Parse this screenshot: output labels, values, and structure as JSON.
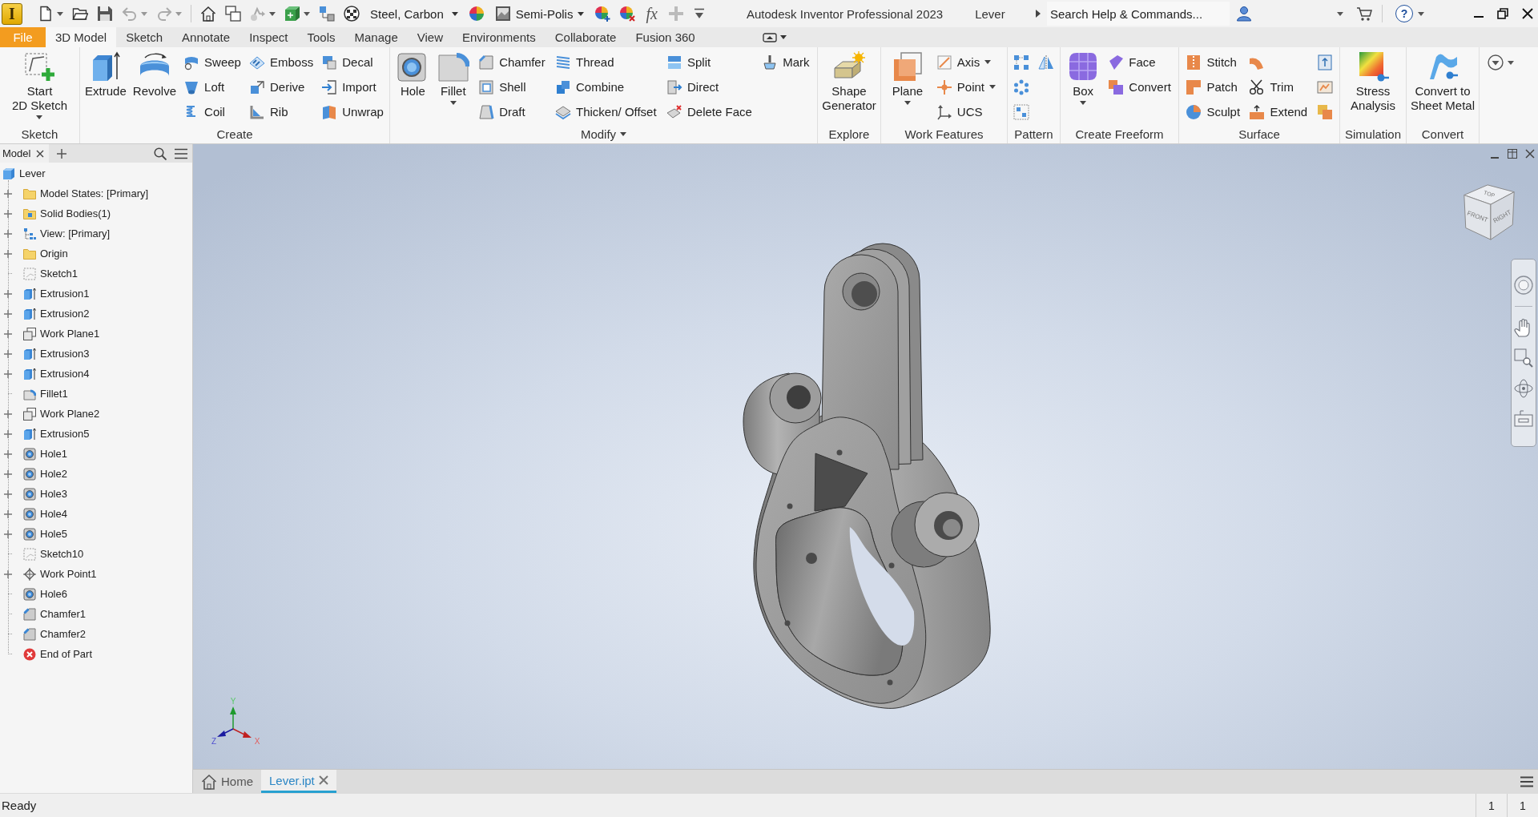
{
  "quick_access": {
    "logo": "I",
    "material": "Steel, Carbon",
    "appearance": "Semi-Polis",
    "parameters": "fx"
  },
  "title_bar": {
    "title": "Autodesk Inventor Professional 2023",
    "document": "Lever",
    "search": {
      "placeholder": "Search Help & Commands..."
    },
    "help": "?"
  },
  "ribbon_tabs": [
    {
      "label": "File",
      "kind": "file",
      "selected": false
    },
    {
      "label": "3D Model",
      "kind": "tab",
      "selected": true
    },
    {
      "label": "Sketch",
      "kind": "tab",
      "selected": false
    },
    {
      "label": "Annotate",
      "kind": "tab",
      "selected": false
    },
    {
      "label": "Inspect",
      "kind": "tab",
      "selected": false
    },
    {
      "label": "Tools",
      "kind": "tab",
      "selected": false
    },
    {
      "label": "Manage",
      "kind": "tab",
      "selected": false
    },
    {
      "label": "View",
      "kind": "tab",
      "selected": false
    },
    {
      "label": "Environments",
      "kind": "tab",
      "selected": false
    },
    {
      "label": "Collaborate",
      "kind": "tab",
      "selected": false
    },
    {
      "label": "Fusion 360",
      "kind": "tab",
      "selected": false
    }
  ],
  "ribbon_panels": [
    {
      "label": "Sketch",
      "dropdown": false,
      "large": [
        {
          "label": "Start\n2D Sketch",
          "dropdown": true
        }
      ]
    },
    {
      "label": "Create",
      "dropdown": false,
      "large": [
        {
          "label": "Extrude",
          "dropdown": false
        },
        {
          "label": "Revolve",
          "dropdown": false
        }
      ],
      "columns": [
        [
          {
            "label": "Sweep",
            "dropdown": false
          },
          {
            "label": "Loft",
            "dropdown": false
          },
          {
            "label": "Coil",
            "dropdown": false
          }
        ],
        [
          {
            "label": "Emboss",
            "dropdown": false
          },
          {
            "label": "Derive",
            "dropdown": false
          },
          {
            "label": "Rib",
            "dropdown": false
          }
        ],
        [
          {
            "label": "Decal",
            "dropdown": false
          },
          {
            "label": "Import",
            "dropdown": false
          },
          {
            "label": "Unwrap",
            "dropdown": false
          }
        ]
      ]
    },
    {
      "label": "Modify",
      "dropdown": true,
      "large": [
        {
          "label": "Hole",
          "dropdown": false
        },
        {
          "label": "Fillet",
          "dropdown": true
        }
      ],
      "columns": [
        [
          {
            "label": "Chamfer",
            "dropdown": false
          },
          {
            "label": "Shell",
            "dropdown": false
          },
          {
            "label": "Draft",
            "dropdown": false
          }
        ],
        [
          {
            "label": "Thread",
            "dropdown": false
          },
          {
            "label": "Combine",
            "dropdown": false
          },
          {
            "label": "Thicken/ Offset",
            "dropdown": false
          }
        ],
        [
          {
            "label": "Split",
            "dropdown": false
          },
          {
            "label": "Direct",
            "dropdown": false
          },
          {
            "label": "Delete Face",
            "dropdown": false
          }
        ],
        [
          {
            "label": "Mark",
            "dropdown": false
          }
        ]
      ]
    },
    {
      "label": "Explore",
      "dropdown": false,
      "large": [
        {
          "label": "Shape\nGenerator",
          "dropdown": false
        }
      ]
    },
    {
      "label": "Work Features",
      "dropdown": false,
      "large": [
        {
          "label": "Plane",
          "dropdown": true
        }
      ],
      "columns": [
        [
          {
            "label": "Axis",
            "dropdown": true
          },
          {
            "label": "Point",
            "dropdown": true
          },
          {
            "label": "UCS",
            "dropdown": false
          }
        ]
      ]
    },
    {
      "label": "Pattern",
      "dropdown": false,
      "columns": [
        [
          {
            "dropdown": false
          },
          {
            "dropdown": false
          },
          {
            "dropdown": false
          }
        ],
        [
          {
            "dropdown": false
          }
        ]
      ]
    },
    {
      "label": "Create Freeform",
      "dropdown": false,
      "large": [
        {
          "label": "Box",
          "dropdown": true
        }
      ],
      "columns": [
        [
          {
            "label": "Face",
            "dropdown": false
          },
          {
            "label": "Convert",
            "dropdown": false
          }
        ]
      ]
    },
    {
      "label": "Surface",
      "dropdown": false,
      "columns": [
        [
          {
            "label": "Stitch",
            "dropdown": false
          },
          {
            "label": "Patch",
            "dropdown": false
          },
          {
            "label": "Sculpt",
            "dropdown": false
          }
        ],
        [
          {
            "dropdown": false
          },
          {
            "label": "Trim",
            "dropdown": false
          },
          {
            "label": "Extend",
            "dropdown": false
          }
        ],
        [
          {
            "dropdown": false
          },
          {
            "dropdown": false
          },
          {
            "dropdown": false
          }
        ]
      ]
    },
    {
      "label": "Simulation",
      "dropdown": false,
      "large": [
        {
          "label": "Stress\nAnalysis",
          "dropdown": false
        }
      ]
    },
    {
      "label": "Convert",
      "dropdown": false,
      "large": [
        {
          "label": "Convert to\nSheet Metal",
          "dropdown": false
        }
      ]
    }
  ],
  "browser": {
    "tab": "Model",
    "tree": {
      "label": "Lever",
      "kind": "part",
      "children": [
        {
          "label": "Model States: [Primary]",
          "kind": "folder",
          "expandable": true
        },
        {
          "label": "Solid Bodies(1)",
          "kind": "bodies",
          "expandable": true
        },
        {
          "label": "View: [Primary]",
          "kind": "view",
          "expandable": true
        },
        {
          "label": "Origin",
          "kind": "folder",
          "expandable": true
        },
        {
          "label": "Sketch1",
          "kind": "sketch",
          "expandable": false
        },
        {
          "label": "Extrusion1",
          "kind": "extrusion",
          "expandable": true
        },
        {
          "label": "Extrusion2",
          "kind": "extrusion",
          "expandable": true
        },
        {
          "label": "Work Plane1",
          "kind": "work_plane",
          "expandable": true
        },
        {
          "label": "Extrusion3",
          "kind": "extrusion",
          "expandable": true
        },
        {
          "label": "Extrusion4",
          "kind": "extrusion",
          "expandable": true
        },
        {
          "label": "Fillet1",
          "kind": "fillet",
          "expandable": false
        },
        {
          "label": "Work Plane2",
          "kind": "work_plane",
          "expandable": true
        },
        {
          "label": "Extrusion5",
          "kind": "extrusion",
          "expandable": true
        },
        {
          "label": "Hole1",
          "kind": "hole",
          "expandable": true
        },
        {
          "label": "Hole2",
          "kind": "hole",
          "expandable": true
        },
        {
          "label": "Hole3",
          "kind": "hole",
          "expandable": true
        },
        {
          "label": "Hole4",
          "kind": "hole",
          "expandable": true
        },
        {
          "label": "Hole5",
          "kind": "hole",
          "expandable": true
        },
        {
          "label": "Sketch10",
          "kind": "sketch",
          "expandable": false
        },
        {
          "label": "Work Point1",
          "kind": "work_point",
          "expandable": true
        },
        {
          "label": "Hole6",
          "kind": "hole",
          "expandable": false
        },
        {
          "label": "Chamfer1",
          "kind": "chamfer",
          "expandable": false
        },
        {
          "label": "Chamfer2",
          "kind": "chamfer",
          "expandable": false
        },
        {
          "label": "End of Part",
          "kind": "end",
          "expandable": false
        }
      ]
    }
  },
  "viewport": {
    "view_cube": {
      "top": "TOP",
      "front": "FRONT",
      "right": "RIGHT"
    },
    "triad": {
      "x": "X",
      "y": "Y",
      "z": "Z"
    }
  },
  "document_tabs": [
    {
      "label": "Home",
      "kind": "home",
      "selected": false
    },
    {
      "label": "Lever.ipt",
      "kind": "document",
      "selected": true
    }
  ],
  "status_bar": {
    "message": "Ready",
    "counters": [
      "1",
      "1"
    ]
  }
}
